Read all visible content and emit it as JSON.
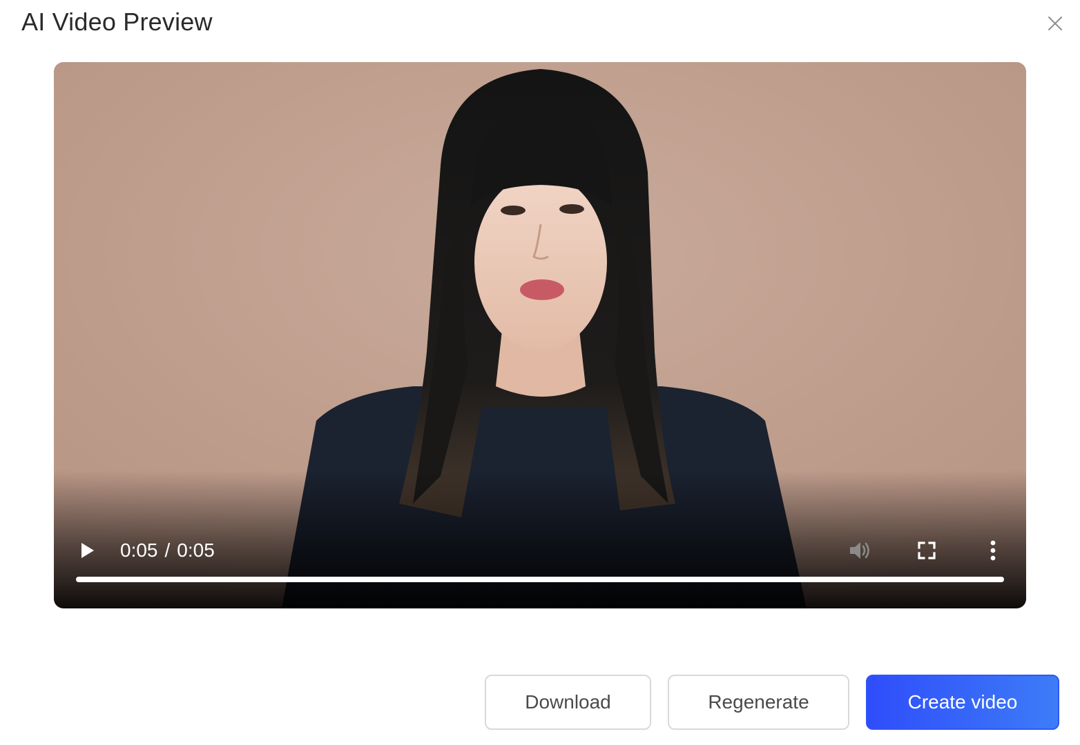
{
  "dialog": {
    "title": "AI Video Preview",
    "close_icon": "close-icon"
  },
  "video": {
    "current_time": "0:05",
    "separator": "/",
    "duration": "0:05",
    "progress": 1.0,
    "icons": {
      "play": "play-icon",
      "volume": "volume-icon",
      "fullscreen": "fullscreen-icon",
      "more": "more-vertical-icon"
    }
  },
  "actions": {
    "download_label": "Download",
    "regenerate_label": "Regenerate",
    "create_label": "Create video"
  },
  "colors": {
    "primary_start": "#2f4dfb",
    "primary_end": "#3d7cf7",
    "video_background": "#c4a595"
  }
}
